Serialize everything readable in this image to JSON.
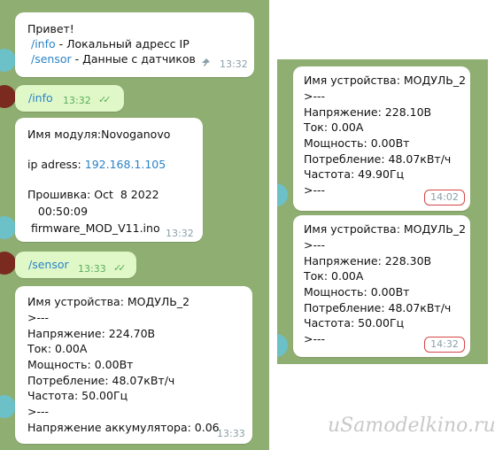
{
  "left_chat": {
    "msg1": {
      "lines": [
        "Привет!"
      ],
      "cmd1": "/info",
      "cmd1_desc": " - Локальный адресс IP",
      "cmd2": "/sensor",
      "cmd2_desc": " - Данные с датчиков",
      "time": "13:32"
    },
    "msg2": {
      "text": "/info",
      "time": "13:32"
    },
    "msg3": {
      "line1": "Имя модуля:Novoganovo",
      "ip_label": "ip adress: ",
      "ip_value": "192.168.1.105",
      "line3": "Прошивка: Oct  8 2022",
      "line4": "   00:50:09",
      "line5": " firmware_MOD_V11.ino",
      "time": "13:32"
    },
    "msg4": {
      "text": "/sensor",
      "time": "13:33"
    },
    "msg5": {
      "lines": [
        "Имя устройства: МОДУЛЬ_2",
        ">---",
        "Напряжение: 224.70В",
        "Ток: 0.00А",
        "Мощность: 0.00Вт",
        "Потребление: 48.07кВт/ч",
        "Частота: 50.00Гц",
        ">---",
        "Напряжение аккумулятора: 0.06"
      ],
      "time": "13:33"
    }
  },
  "right_chat": {
    "msg1": {
      "lines": [
        "Имя устройства: МОДУЛЬ_2",
        ">---",
        "Напряжение: 228.10В",
        "Ток: 0.00А",
        "Мощность: 0.00Вт",
        "Потребление: 48.07кВт/ч",
        "Частота: 49.90Гц",
        ">---"
      ],
      "time": "14:02"
    },
    "msg2": {
      "lines": [
        "Имя устройства: МОДУЛЬ_2",
        ">---",
        "Напряжение: 228.30В",
        "Ток: 0.00А",
        "Мощность: 0.00Вт",
        "Потребление: 48.07кВт/ч",
        "Частота: 50.00Гц",
        ">---"
      ],
      "time": "14:32"
    }
  },
  "watermark": "uSamodelkino.ru",
  "colors": {
    "chat_bg": "#8fae72",
    "outgoing_bubble": "#e0f8c8",
    "link": "#2a83c7",
    "highlight_circle": "#d64545"
  },
  "icons": {
    "pin": "pin-icon",
    "read_receipt": "double-check-icon"
  }
}
